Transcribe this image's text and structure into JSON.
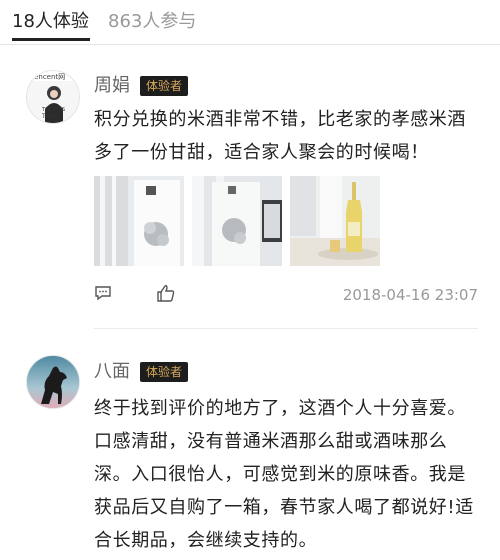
{
  "tabs": [
    {
      "label": "18人体验"
    },
    {
      "label": "863人参与"
    }
  ],
  "reviews": [
    {
      "author": "周娟",
      "badge": "体验者",
      "text": "积分兑换的米酒非常不错，比老家的孝感米酒多了一份甘甜，适合家人聚会的时候喝！",
      "date": "2018-04-16 23:07",
      "avatar_text": [
        "Tencent网",
        "TODAY IS",
        "T-DAY"
      ]
    },
    {
      "author": "八面",
      "badge": "体验者",
      "text": "终于找到评价的地方了，这酒个人十分喜爱。口感清甜，没有普通米酒那么甜或酒味那么深。入口很怡人，可感觉到米的原味香。我是获品后又自购了一箱，春节家人喝了都说好!适合长期品，会继续支持的。"
    }
  ],
  "icons": {
    "comment": "comment-icon",
    "like": "thumbs-up-icon"
  },
  "colors": {
    "badge_bg": "#1d1d1d",
    "badge_text": "#d8a85a",
    "muted": "#999999"
  }
}
